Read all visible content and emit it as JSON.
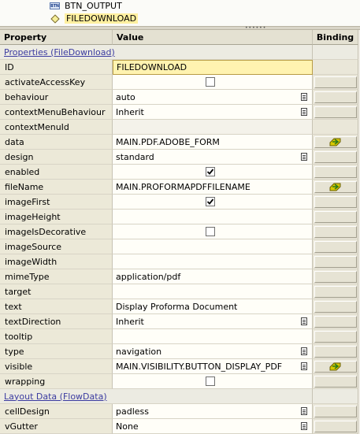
{
  "tree": {
    "items": [
      {
        "label": "BTN_OUTPUT",
        "icon": "button-element-icon",
        "icon_text": "BTN"
      },
      {
        "label": "FILEDOWNLOAD",
        "icon": "filedownload-element-icon",
        "selected": true
      }
    ]
  },
  "grid": {
    "headers": {
      "property": "Property",
      "value": "Value",
      "binding": "Binding"
    },
    "sections": [
      {
        "title": "Properties (FileDownload)",
        "rows": [
          {
            "name": "ID",
            "value": "FILEDOWNLOAD",
            "kind": "id",
            "binding": "none"
          },
          {
            "name": "activateAccessKey",
            "value": "",
            "kind": "checkbox",
            "checked": false,
            "binding": "button"
          },
          {
            "name": "behaviour",
            "value": "auto",
            "kind": "dropdown",
            "binding": "button"
          },
          {
            "name": "contextMenuBehaviour",
            "value": "Inherit",
            "kind": "dropdown",
            "binding": "button"
          },
          {
            "name": "contextMenuId",
            "value": "",
            "kind": "readonly",
            "binding": "none"
          },
          {
            "name": "data",
            "value": "MAIN.PDF.ADOBE_FORM",
            "kind": "text",
            "binding": "bound"
          },
          {
            "name": "design",
            "value": "standard",
            "kind": "dropdown",
            "binding": "button"
          },
          {
            "name": "enabled",
            "value": "",
            "kind": "checkbox",
            "checked": true,
            "binding": "button"
          },
          {
            "name": "fileName",
            "value": "MAIN.PROFORMAPDFFILENAME",
            "kind": "text",
            "binding": "bound"
          },
          {
            "name": "imageFirst",
            "value": "",
            "kind": "checkbox",
            "checked": true,
            "binding": "button"
          },
          {
            "name": "imageHeight",
            "value": "",
            "kind": "text",
            "binding": "button"
          },
          {
            "name": "imageIsDecorative",
            "value": "",
            "kind": "checkbox",
            "checked": false,
            "binding": "button"
          },
          {
            "name": "imageSource",
            "value": "",
            "kind": "text",
            "binding": "button"
          },
          {
            "name": "imageWidth",
            "value": "",
            "kind": "text",
            "binding": "button"
          },
          {
            "name": "mimeType",
            "value": "application/pdf",
            "kind": "text",
            "binding": "button"
          },
          {
            "name": "target",
            "value": "",
            "kind": "text",
            "binding": "button"
          },
          {
            "name": "text",
            "value": "Display Proforma Document",
            "kind": "text",
            "binding": "button"
          },
          {
            "name": "textDirection",
            "value": "Inherit",
            "kind": "dropdown",
            "binding": "button"
          },
          {
            "name": "tooltip",
            "value": "",
            "kind": "text",
            "binding": "button"
          },
          {
            "name": "type",
            "value": "navigation",
            "kind": "dropdown",
            "binding": "button"
          },
          {
            "name": "visible",
            "value": "MAIN.VISIBILITY.BUTTON_DISPLAY_PDF",
            "kind": "dropdown",
            "binding": "bound"
          },
          {
            "name": "wrapping",
            "value": "",
            "kind": "checkbox",
            "checked": false,
            "binding": "button"
          }
        ]
      },
      {
        "title": "Layout Data (FlowData)",
        "rows": [
          {
            "name": "cellDesign",
            "value": "padless",
            "kind": "dropdown",
            "binding": "button"
          },
          {
            "name": "vGutter",
            "value": "None",
            "kind": "dropdown",
            "binding": "button"
          }
        ]
      }
    ]
  },
  "colors": {
    "selected_id_bg": "#fff3b0",
    "section_link": "#3b3ba0",
    "bound_icon": "#c8b400"
  }
}
